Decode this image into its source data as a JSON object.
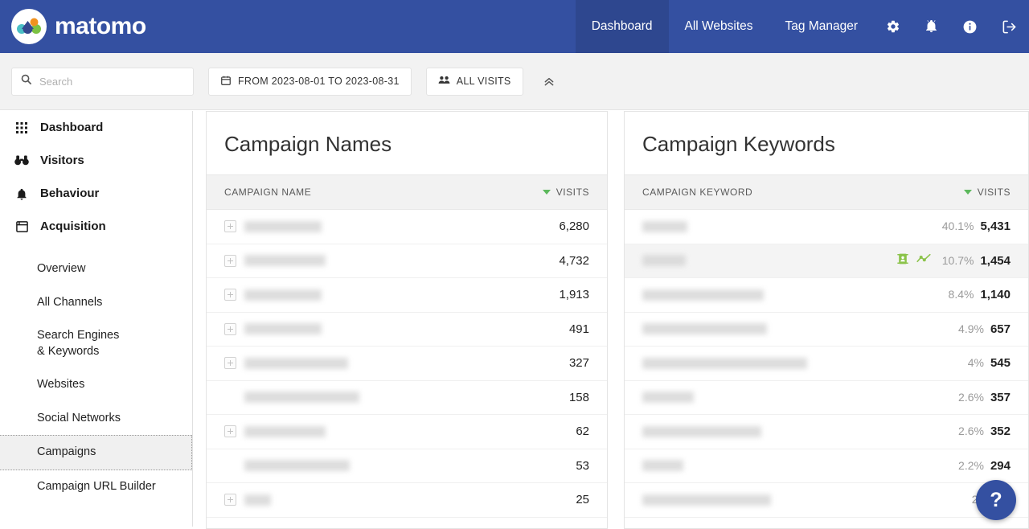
{
  "header": {
    "brand": "matomo",
    "nav": [
      {
        "label": "Dashboard",
        "active": true
      },
      {
        "label": "All Websites",
        "active": false
      },
      {
        "label": "Tag Manager",
        "active": false
      }
    ],
    "icons": [
      {
        "name": "gear-icon"
      },
      {
        "name": "bell-icon"
      },
      {
        "name": "info-icon"
      },
      {
        "name": "logout-icon"
      }
    ],
    "brand_color": "#3450a1",
    "active_color": "#2e478f"
  },
  "toolbar": {
    "search_placeholder": "Search",
    "search_value": "",
    "date_range": "FROM 2023-08-01 TO 2023-08-31",
    "segment": "ALL VISITS",
    "collapse_label": "«"
  },
  "sidebar": {
    "items": [
      {
        "label": "Dashboard",
        "icon": "grid-icon",
        "type": "main"
      },
      {
        "label": "Visitors",
        "icon": "binoculars-icon",
        "type": "main"
      },
      {
        "label": "Behaviour",
        "icon": "bell-icon",
        "type": "main"
      },
      {
        "label": "Acquisition",
        "icon": "window-icon",
        "type": "main"
      },
      {
        "label": "Overview",
        "type": "sub"
      },
      {
        "label": "All Channels",
        "type": "sub"
      },
      {
        "label": "Search Engines & Keywords",
        "type": "sub"
      },
      {
        "label": "Websites",
        "type": "sub"
      },
      {
        "label": "Social Networks",
        "type": "sub"
      },
      {
        "label": "Campaigns",
        "type": "sub",
        "selected": true
      },
      {
        "label": "Campaign URL Builder",
        "type": "sub"
      }
    ]
  },
  "panels": {
    "campaign_names": {
      "title": "Campaign Names",
      "column_label": "CAMPAIGN NAME",
      "metric_label": "VISITS",
      "sort_color": "#5cb85c",
      "rows": [
        {
          "label": "",
          "label_width": 96,
          "expandable": true,
          "visits": "6,280"
        },
        {
          "label": "",
          "label_width": 101,
          "expandable": true,
          "visits": "4,732"
        },
        {
          "label": "",
          "label_width": 96,
          "expandable": true,
          "visits": "1,913"
        },
        {
          "label": "",
          "label_width": 96,
          "expandable": true,
          "visits": "491"
        },
        {
          "label": "",
          "label_width": 129,
          "expandable": true,
          "visits": "327"
        },
        {
          "label": "",
          "label_width": 143,
          "expandable": false,
          "visits": "158"
        },
        {
          "label": "",
          "label_width": 101,
          "expandable": true,
          "visits": "62"
        },
        {
          "label": "",
          "label_width": 131,
          "expandable": false,
          "visits": "53"
        },
        {
          "label": "",
          "label_width": 33,
          "expandable": true,
          "visits": "25"
        }
      ]
    },
    "campaign_keywords": {
      "title": "Campaign Keywords",
      "column_label": "CAMPAIGN KEYWORD",
      "metric_label": "VISITS",
      "sort_color": "#5cb85c",
      "action_icons": [
        {
          "name": "segmented-visits-log-icon",
          "color": "#8bc34a"
        },
        {
          "name": "row-evolution-icon",
          "color": "#8bc34a"
        }
      ],
      "rows": [
        {
          "label": "",
          "label_width": 56,
          "pct": "40.1%",
          "visits": "5,431",
          "hovered": false
        },
        {
          "label": "",
          "label_width": 54,
          "pct": "10.7%",
          "visits": "1,454",
          "hovered": true
        },
        {
          "label": "",
          "label_width": 151,
          "pct": "8.4%",
          "visits": "1,140",
          "hovered": false
        },
        {
          "label": "",
          "label_width": 155,
          "pct": "4.9%",
          "visits": "657",
          "hovered": false
        },
        {
          "label": "",
          "label_width": 205,
          "pct": "4%",
          "visits": "545",
          "hovered": false
        },
        {
          "label": "",
          "label_width": 64,
          "pct": "2.6%",
          "visits": "357",
          "hovered": false
        },
        {
          "label": "",
          "label_width": 148,
          "pct": "2.6%",
          "visits": "352",
          "hovered": false
        },
        {
          "label": "",
          "label_width": 51,
          "pct": "2.2%",
          "visits": "294",
          "hovered": false
        },
        {
          "label": "",
          "label_width": 160,
          "pct": "2.1%",
          "visits": "2",
          "hovered": false
        }
      ]
    }
  },
  "help": {
    "label": "?"
  }
}
